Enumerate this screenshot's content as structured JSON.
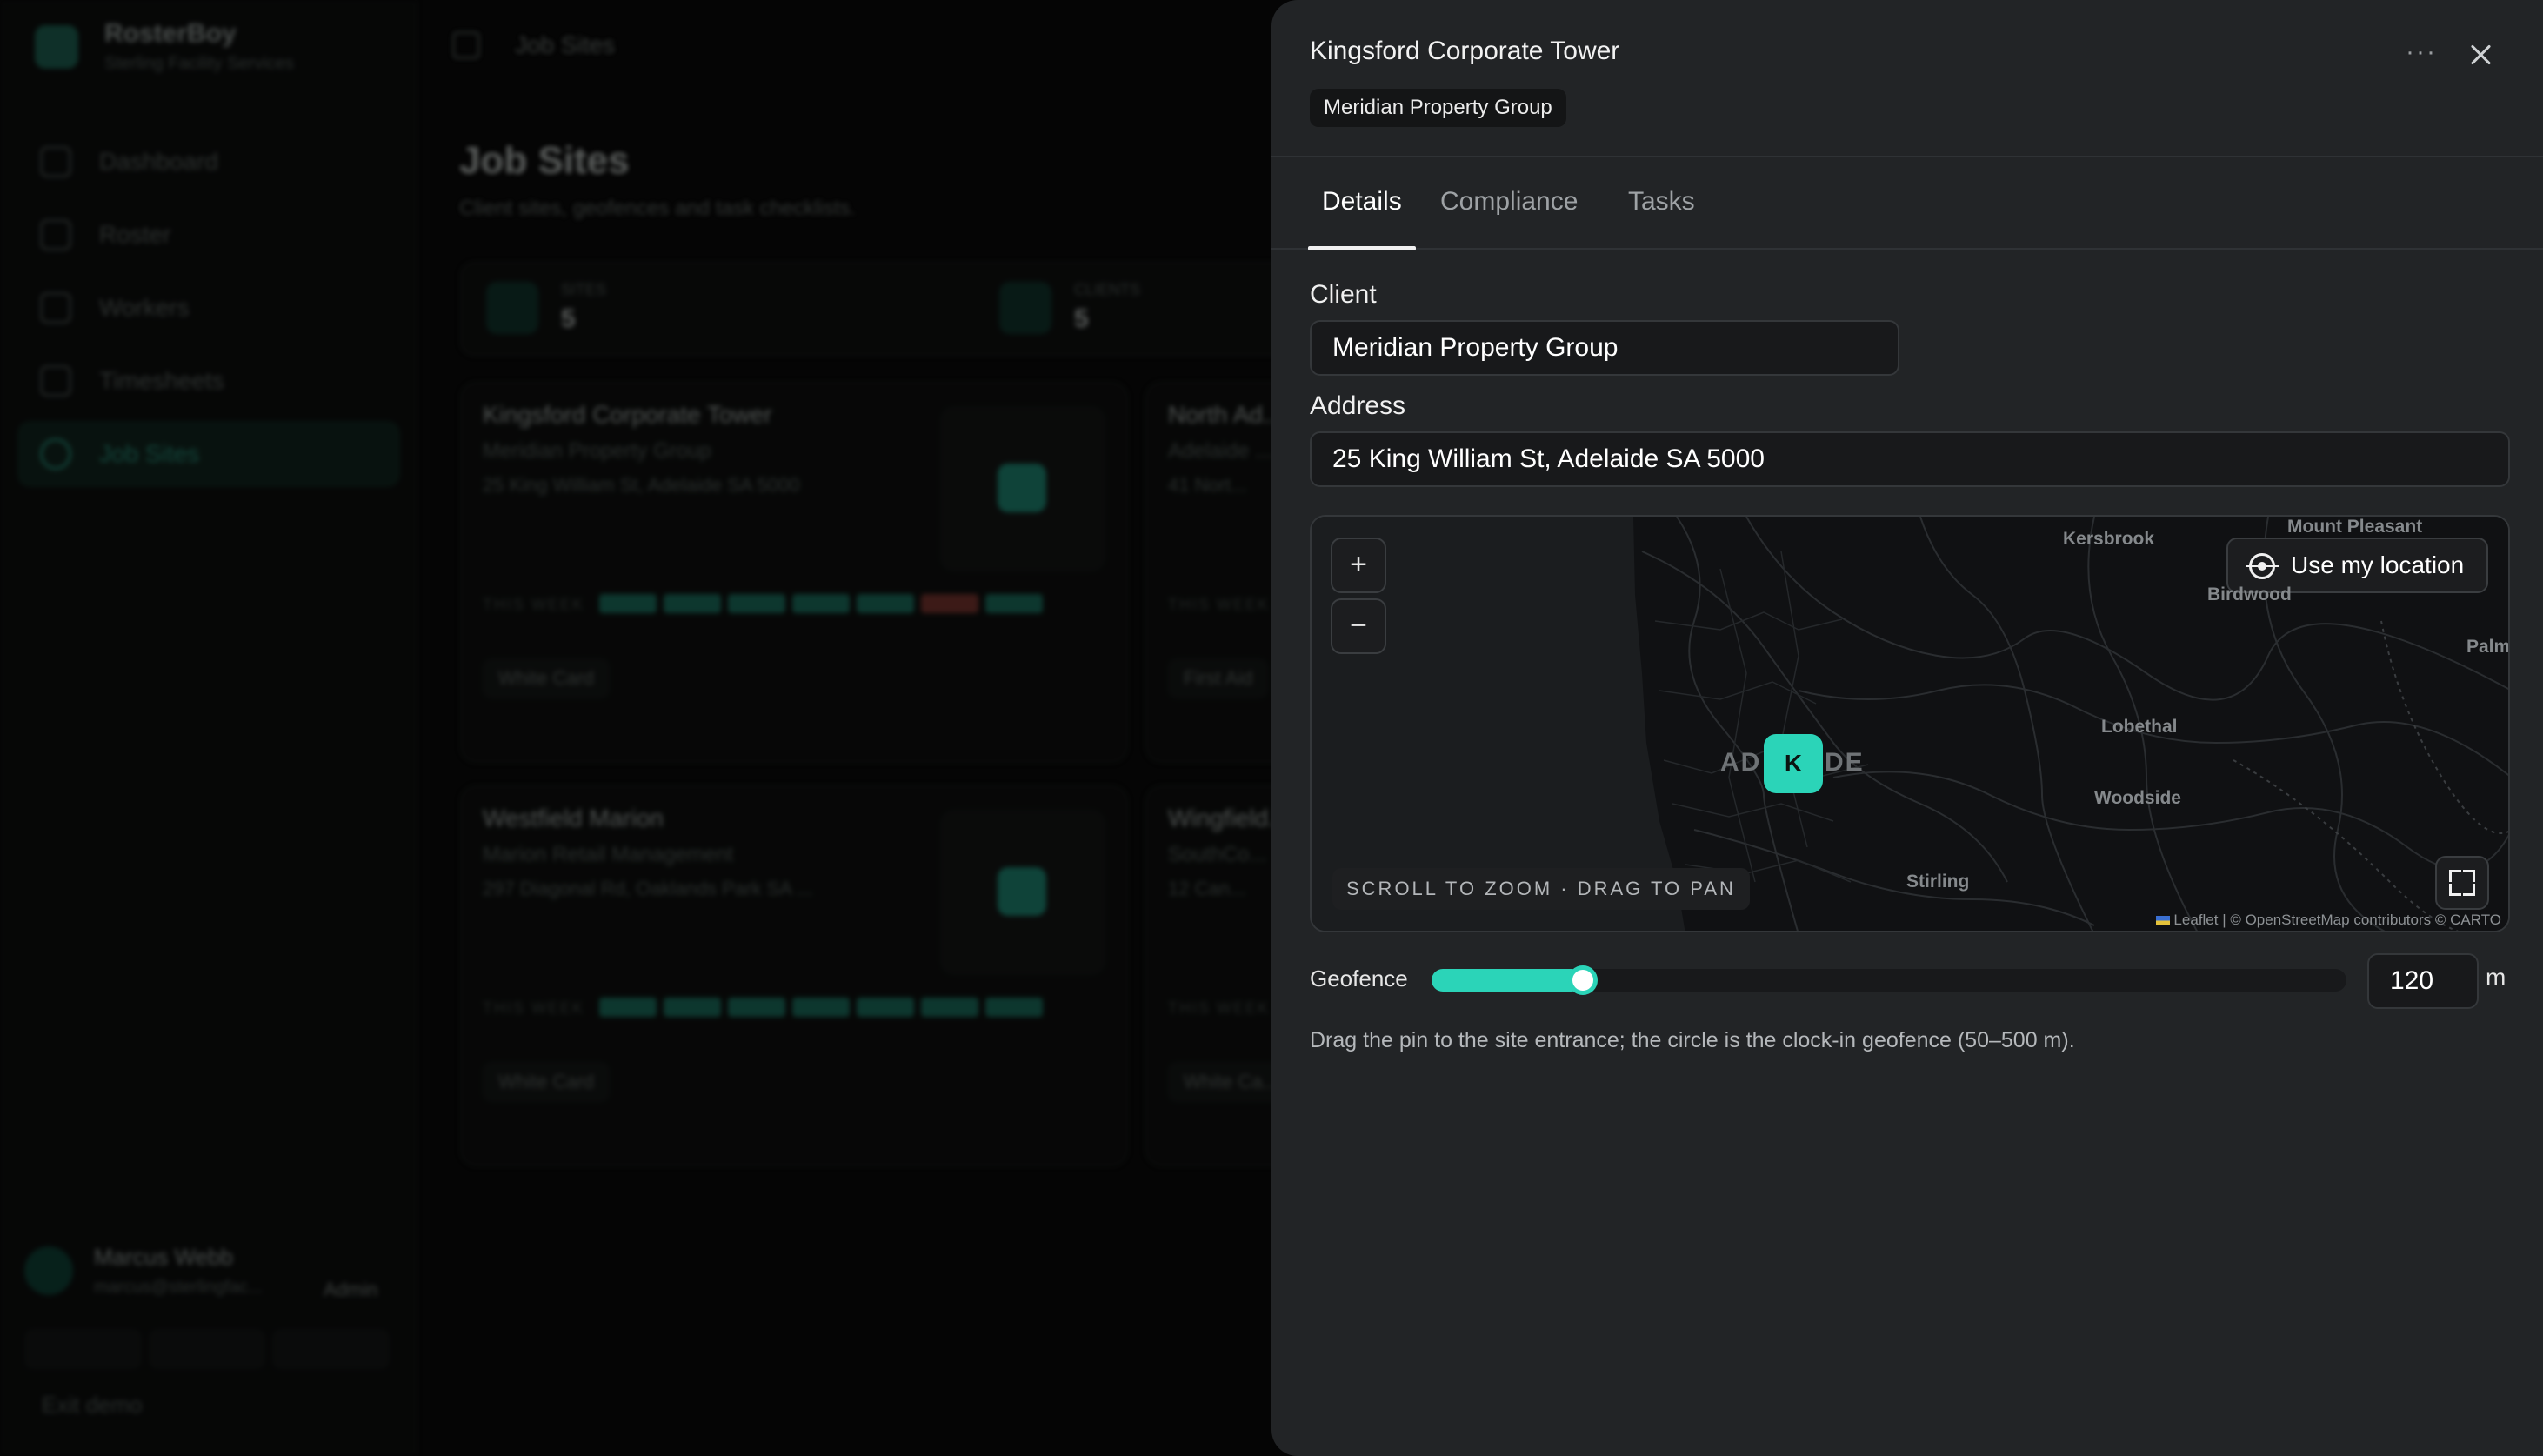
{
  "background": {
    "brand": {
      "name": "RosterBoy",
      "subtitle": "Sterling Facility Services"
    },
    "nav": [
      {
        "label": "Dashboard"
      },
      {
        "label": "Roster"
      },
      {
        "label": "Workers"
      },
      {
        "label": "Timesheets"
      },
      {
        "label": "Job Sites",
        "active": true
      }
    ],
    "user": {
      "name": "Marcus Webb",
      "email": "marcus@sterlingfac...",
      "role": "Admin"
    },
    "exit_label": "Exit demo",
    "breadcrumb": "Job Sites",
    "page_title": "Job Sites",
    "page_subtitle": "Client sites, geofences and task checklists.",
    "stats": [
      {
        "label": "SITES",
        "value": "5"
      },
      {
        "label": "CLIENTS",
        "value": "5"
      }
    ],
    "cards": [
      {
        "name": "Kingsford Corporate Tower",
        "client": "Meridian Property Group",
        "address": "25 King William St, Adelaide SA 5000",
        "week_label": "THIS WEEK",
        "chip": "White Card"
      },
      {
        "name": "North Ad...",
        "client": "Adelaide ...",
        "address": "41 Nort...",
        "week_label": "THIS WEEK",
        "chip": "First Aid"
      },
      {
        "name": "Westfield Marion",
        "client": "Marion Retail Management",
        "address": "297 Diagonal Rd, Oaklands Park SA ...",
        "week_label": "THIS WEEK",
        "chip": "White Card"
      },
      {
        "name": "Wingfield...",
        "client": "SouthCo...",
        "address": "12 Can...",
        "week_label": "THIS WEEK",
        "chip": "White Ca..."
      }
    ]
  },
  "panel": {
    "title": "Kingsford Corporate Tower",
    "client_badge": "Meridian Property Group",
    "tabs": [
      {
        "label": "Details",
        "active": true
      },
      {
        "label": "Compliance"
      },
      {
        "label": "Tasks"
      }
    ],
    "client_label": "Client",
    "client_value": "Meridian Property Group",
    "address_label": "Address",
    "address_value": "25 King William St, Adelaide SA 5000",
    "map": {
      "zoom_in": "+",
      "zoom_out": "−",
      "use_location": "Use my location",
      "hint": "SCROLL TO ZOOM · DRAG TO PAN",
      "pin_letter": "K",
      "places": {
        "kersbrook": "Kersbrook",
        "mount_pleasant": "Mount Pleasant",
        "birdwood": "Birdwood",
        "palm": "Palm",
        "lobethal": "Lobethal",
        "woodside": "Woodside",
        "stirling": "Stirling",
        "adelaide_left": "AD",
        "adelaide_right": "DE"
      },
      "attribution_leaflet": "Leaflet",
      "attribution_rest": " | © OpenStreetMap contributors © CARTO"
    },
    "geofence_label": "Geofence",
    "geofence_value": "120",
    "geofence_min": 50,
    "geofence_max": 500,
    "geofence_unit": "m",
    "help_text": "Drag the pin to the site entrance; the circle is the clock-in geofence (50–500 m).",
    "colors": {
      "accent": "#2bd4b8",
      "panel_bg": "#222426",
      "field_bg": "#18191b"
    }
  }
}
